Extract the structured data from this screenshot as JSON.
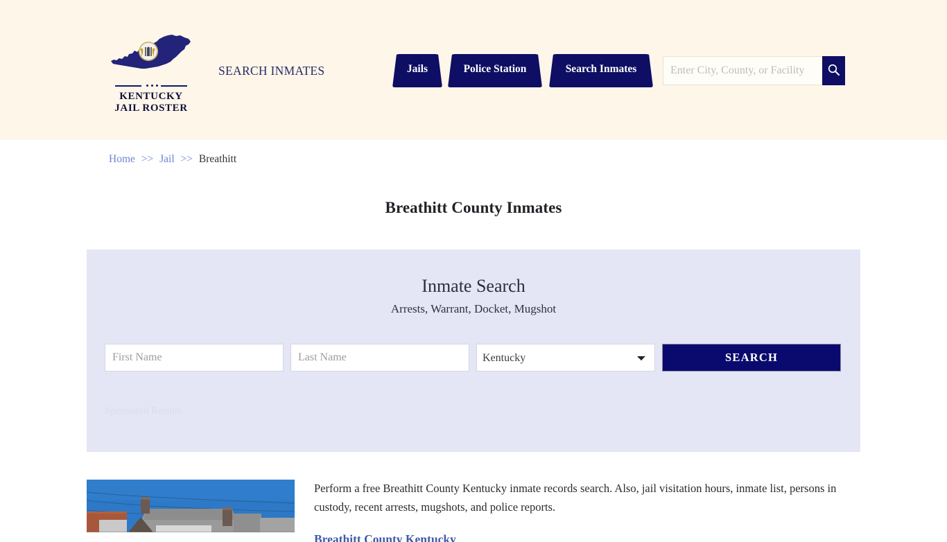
{
  "header": {
    "logo": {
      "icon": "kentucky-state-map-seal",
      "name_line1": "KENTUCKY",
      "name_line2": "JAIL ROSTER"
    },
    "tagline": "SEARCH INMATES",
    "nav": [
      {
        "label": "Jails"
      },
      {
        "label": "Police Station"
      },
      {
        "label": "Search Inmates"
      }
    ],
    "search": {
      "placeholder": "Enter City, County, or Facility",
      "value": "",
      "button_icon": "search-icon"
    },
    "colors": {
      "background": "#fdf6e9",
      "navy": "#0e0e64"
    }
  },
  "breadcrumb": {
    "home": "Home",
    "sep1": ">>",
    "jail": "Jail",
    "sep2": ">>",
    "current": "Breathitt"
  },
  "page": {
    "title": "Breathitt County Inmates"
  },
  "panel": {
    "title": "Inmate Search",
    "subtitle": "Arrests, Warrant, Docket, Mugshot",
    "form": {
      "first_name_placeholder": "First Name",
      "first_name_value": "",
      "last_name_placeholder": "Last Name",
      "last_name_value": "",
      "state_selected": "Kentucky",
      "state_options": [
        "Kentucky"
      ],
      "search_label": "SEARCH"
    },
    "sponsored_label": "Sponsored Results",
    "colors": {
      "background": "#e4e5f5",
      "button": "#0a0a6e"
    }
  },
  "content": {
    "photo_alt": "breathitt-county-jail-building-photo",
    "paragraph": "Perform a free Breathitt County Kentucky inmate records search. Also, jail visitation hours, inmate list, persons in custody, recent arrests, mugshots, and police reports.",
    "subheading": "Breathitt County Kentucky"
  }
}
